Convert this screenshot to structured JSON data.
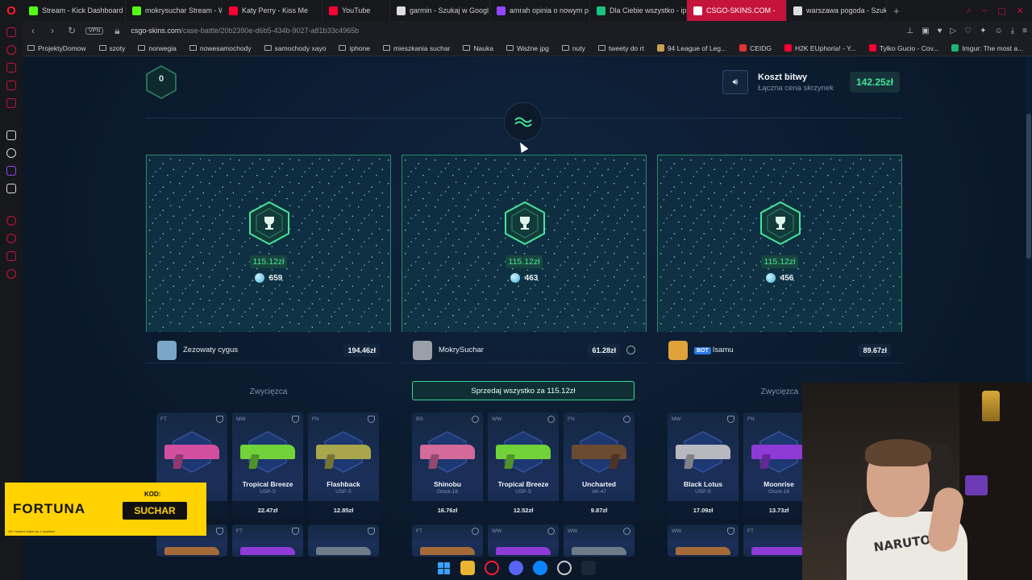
{
  "browser": {
    "tabs": [
      {
        "label": "Stream - Kick Dashboard",
        "color": "#53fc18"
      },
      {
        "label": "mokrysuchar Stream - W",
        "color": "#53fc18"
      },
      {
        "label": "Katy Perry - Kiss Me",
        "color": "#ff0033"
      },
      {
        "label": "YouTube",
        "color": "#ff0033"
      },
      {
        "label": "garmin - Szukaj w Googl",
        "color": "#dddddd"
      },
      {
        "label": "amrah opinia o nowym p",
        "color": "#9146ff"
      },
      {
        "label": "Dla Ciebie wszystko - ip",
        "color": "#19c37d"
      },
      {
        "label": "CSGO-SKINS.COM -",
        "color": "#ffffff",
        "active": true
      },
      {
        "label": "warszawa pogoda - Szuk",
        "color": "#dddddd"
      }
    ],
    "vpn_label": "VPN",
    "url_host": "csgo-skins.com",
    "url_path": "/case-battle/20b2390e-d6b5-434b-9027-a81b33c4965b",
    "bookmarks": [
      {
        "label": "ProjektyDomow",
        "type": "folder"
      },
      {
        "label": "szoty",
        "type": "folder"
      },
      {
        "label": "norwegia",
        "type": "folder"
      },
      {
        "label": "nowesamochody",
        "type": "folder"
      },
      {
        "label": "samochody xayo",
        "type": "folder"
      },
      {
        "label": "iphone",
        "type": "folder"
      },
      {
        "label": "mieszkania suchar",
        "type": "folder"
      },
      {
        "label": "Nauka",
        "type": "folder"
      },
      {
        "label": "Ważne jpg",
        "type": "folder"
      },
      {
        "label": "nuty",
        "type": "folder"
      },
      {
        "label": "tweety do rt",
        "type": "folder"
      },
      {
        "label": "94 League of Leg...",
        "type": "site",
        "color": "#c8a050"
      },
      {
        "label": "CEIDG",
        "type": "site",
        "color": "#d33"
      },
      {
        "label": "H2K EUphoria! - Y...",
        "type": "site",
        "color": "#ff0033"
      },
      {
        "label": "Tylko Gucio - Cov...",
        "type": "site",
        "color": "#ff0033"
      },
      {
        "label": "Imgur: The most a...",
        "type": "site",
        "color": "#1bb76e"
      }
    ]
  },
  "battle": {
    "round": "0",
    "cost_title": "Koszt bitwy",
    "cost_subtitle": "Łączna cena skrzynek",
    "cost_value": "142.25zł",
    "players": [
      {
        "amount": "115.12zł",
        "coins": "659",
        "name": "Zezowaty cygus",
        "value": "194.46zł",
        "bot": false,
        "avatar_color": "#7aa7c7",
        "status": "Zwycięzca",
        "items": [
          {
            "cond": "FT",
            "name": "",
            "weapon": "",
            "price": "",
            "color": "#d24fa0"
          },
          {
            "cond": "MW",
            "name": "Tropical Breeze",
            "weapon": "USP-S",
            "price": "22.47zł",
            "color": "#72d23a"
          },
          {
            "cond": "FN",
            "name": "Flashback",
            "weapon": "USP-S",
            "price": "12.85zł",
            "color": "#a9a64c"
          }
        ],
        "next_conds": [
          "",
          "FT",
          ""
        ]
      },
      {
        "amount": "115.12zł",
        "coins": "463",
        "name": "MokrySuchar",
        "value": "61.28zł",
        "bot": false,
        "avatar_color": "#9aa0a8",
        "sell_label": "Sprzedaj wszystko za 115.12zł",
        "items": [
          {
            "cond": "BS",
            "name": "Shinobu",
            "weapon": "Glock-18",
            "price": "16.76zł",
            "color": "#d46a9a"
          },
          {
            "cond": "WW",
            "name": "Tropical Breeze",
            "weapon": "USP-S",
            "price": "12.52zł",
            "color": "#72d23a"
          },
          {
            "cond": "FN",
            "name": "Uncharted",
            "weapon": "AK-47",
            "price": "9.87zł",
            "color": "#6b4a32"
          }
        ],
        "next_conds": [
          "FT",
          "WW",
          "WW"
        ]
      },
      {
        "amount": "115.12zł",
        "coins": "456",
        "name": "Isamu",
        "value": "89.67zł",
        "bot": true,
        "bot_label": "BOT",
        "avatar_color": "#e0a23a",
        "status": "Zwycięzca",
        "items": [
          {
            "cond": "MW",
            "name": "Black Lotus",
            "weapon": "USP-S",
            "price": "17.09zł",
            "color": "#b8b8c0"
          },
          {
            "cond": "FN",
            "name": "Moonrise",
            "weapon": "Glock-18",
            "price": "13.73zł",
            "color": "#8e3ad6"
          }
        ],
        "next_conds": [
          "WW",
          "FT"
        ]
      }
    ]
  },
  "overlay": {
    "brand": "FORTUNA",
    "kod_label": "KOD:",
    "code": "SUCHAR",
    "fine_print": "18+ Hazard wiąże się z ryzykiem",
    "shirt_text": "NARUTO"
  },
  "colors": {
    "accent_green": "#45e49a",
    "panel_border": "#2e8a6a",
    "page_bg": "#0b1a2e",
    "opera_red": "#c4143b"
  }
}
